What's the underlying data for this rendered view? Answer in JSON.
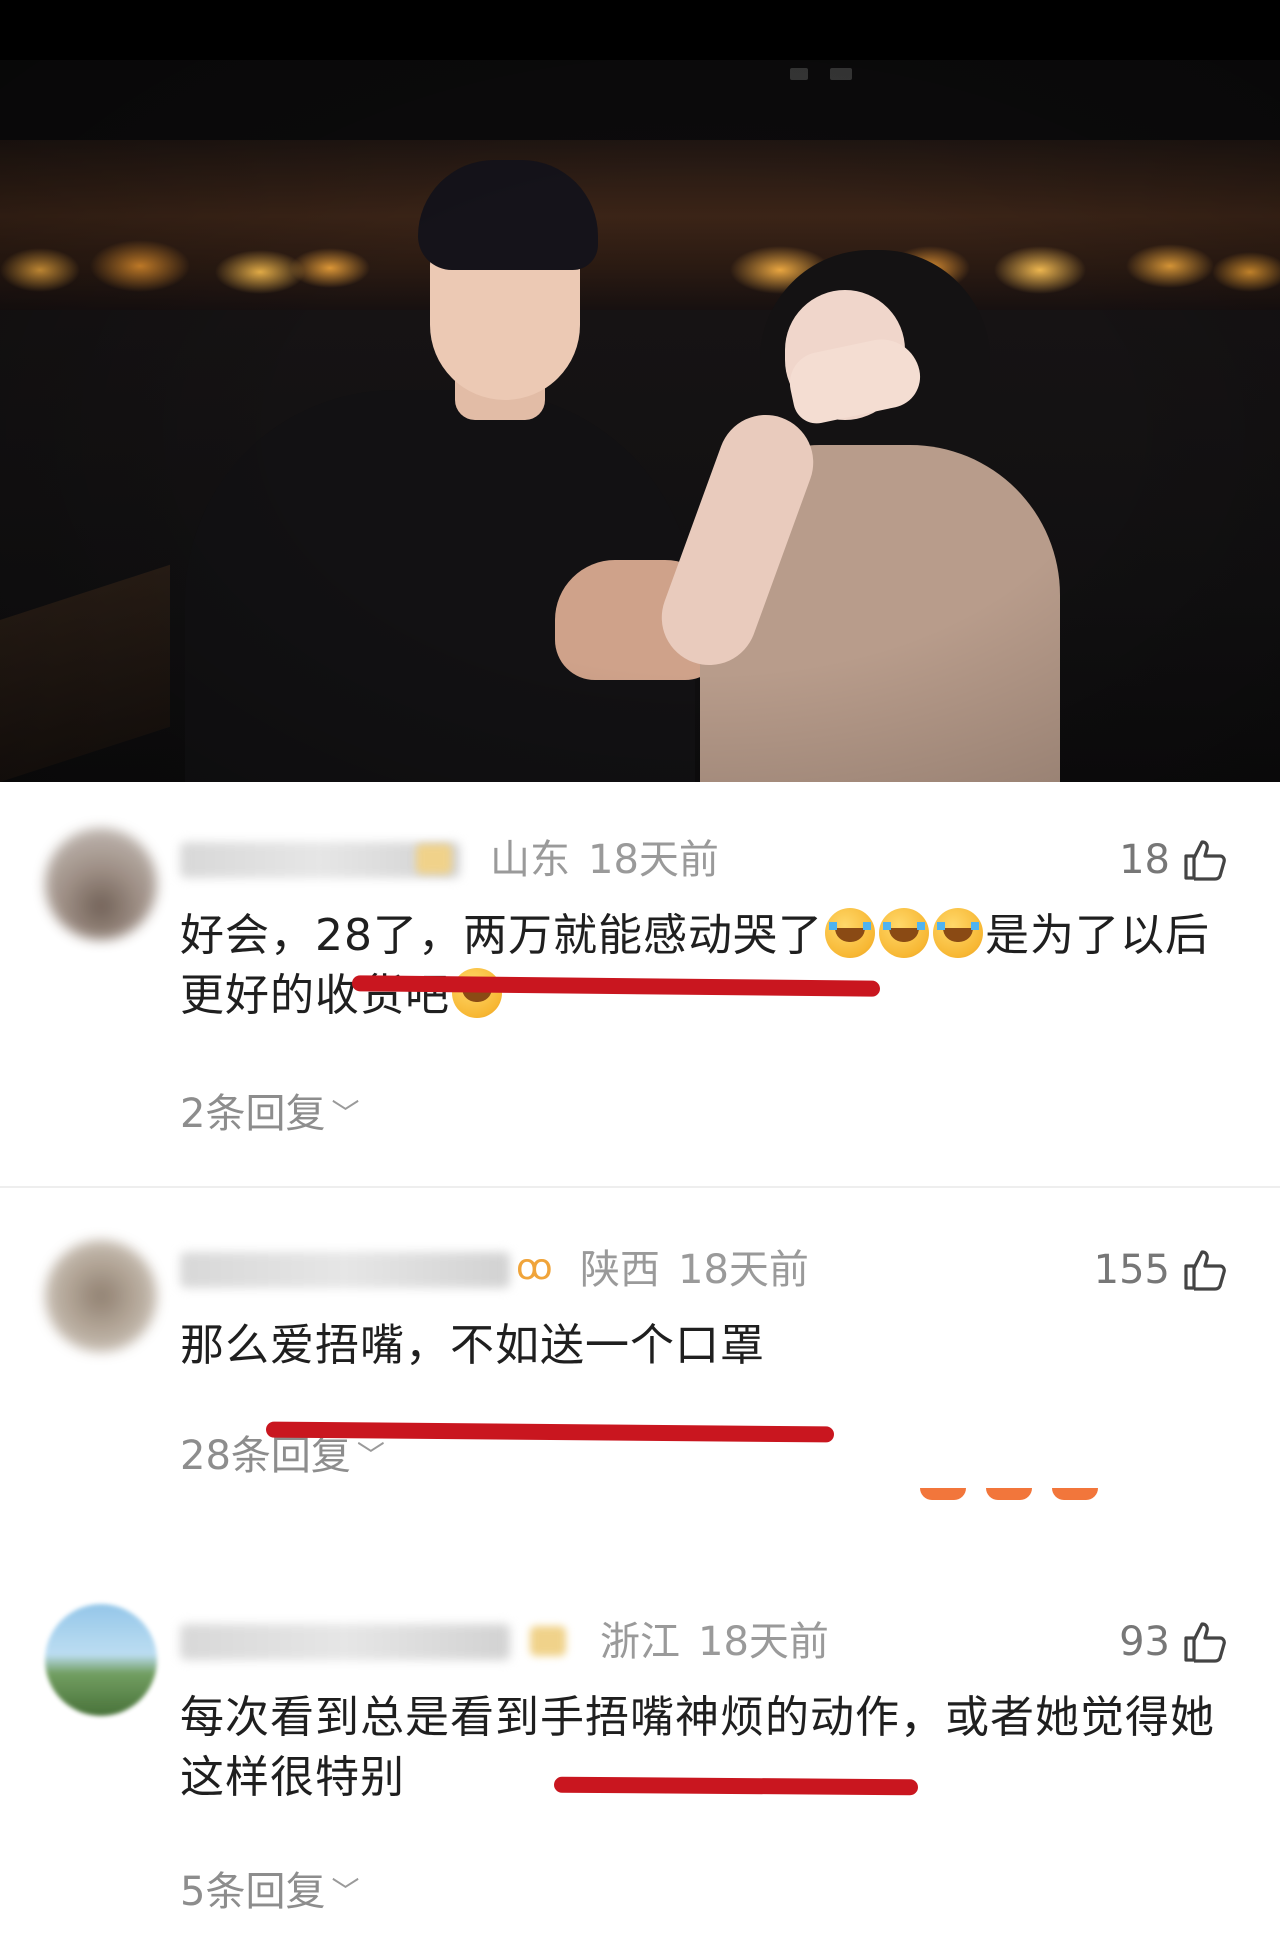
{
  "comments": [
    {
      "location": "山东",
      "time": "18天前",
      "likes": "18",
      "text_part1": "好会，28了，两万就能感动哭了",
      "text_part2": "是为了以后更好的收货吧",
      "replies": "2条回复"
    },
    {
      "location": "陕西",
      "time": "18天前",
      "likes": "155",
      "text": "那么爱捂嘴，不如送一个口罩",
      "replies": "28条回复"
    },
    {
      "location": "浙江",
      "time": "18天前",
      "likes": "93",
      "text": "每次看到总是看到手捂嘴神烦的动作，或者她觉得她这样很特别",
      "replies": "5条回复"
    }
  ],
  "icons": {
    "like": "thumbs-up-icon",
    "emoji": "crying-laughing-emoji",
    "chevron": "chevron-down-icon"
  },
  "colors": {
    "annotation_underline": "#c9161f",
    "badge": "#f0a43a"
  }
}
